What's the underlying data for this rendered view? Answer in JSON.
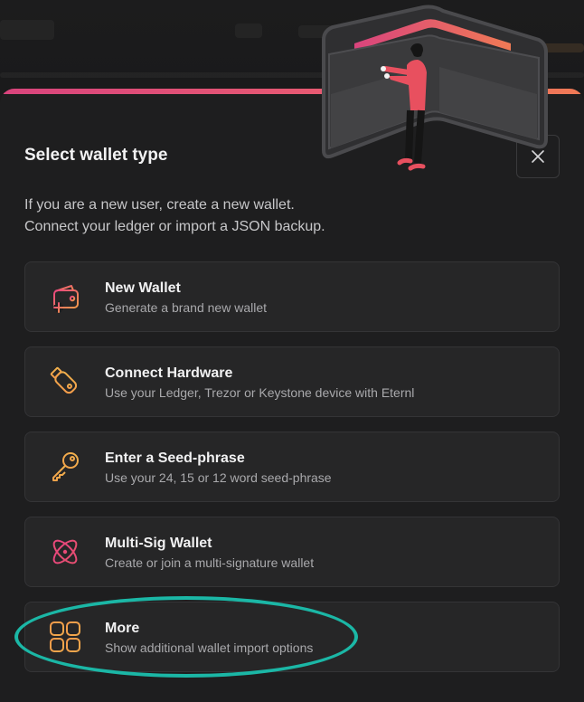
{
  "dialog": {
    "title": "Select wallet type",
    "description_line1": "If you are a new user, create a new wallet.",
    "description_line2": "Connect your ledger or import a JSON backup.",
    "close_icon": "close-icon"
  },
  "options": [
    {
      "label": "New Wallet",
      "sub": "Generate a brand new wallet",
      "icon": "wallet-plus-icon"
    },
    {
      "label": "Connect Hardware",
      "sub": "Use your Ledger, Trezor or Keystone device with Eternl",
      "icon": "usb-device-icon"
    },
    {
      "label": "Enter a Seed-phrase",
      "sub": "Use your 24, 15 or 12 word seed-phrase",
      "icon": "key-icon"
    },
    {
      "label": "Multi-Sig Wallet",
      "sub": "Create or join a multi-signature wallet",
      "icon": "atom-icon"
    },
    {
      "label": "More",
      "sub": "Show additional wallet import options",
      "icon": "grid-icon"
    }
  ],
  "colors": {
    "accent_gradient_start": "#d9447d",
    "accent_gradient_end": "#f07a55",
    "highlight_ring": "#1bb7a6",
    "panel_bg": "#1e1e1f",
    "option_bg": "#262627"
  }
}
